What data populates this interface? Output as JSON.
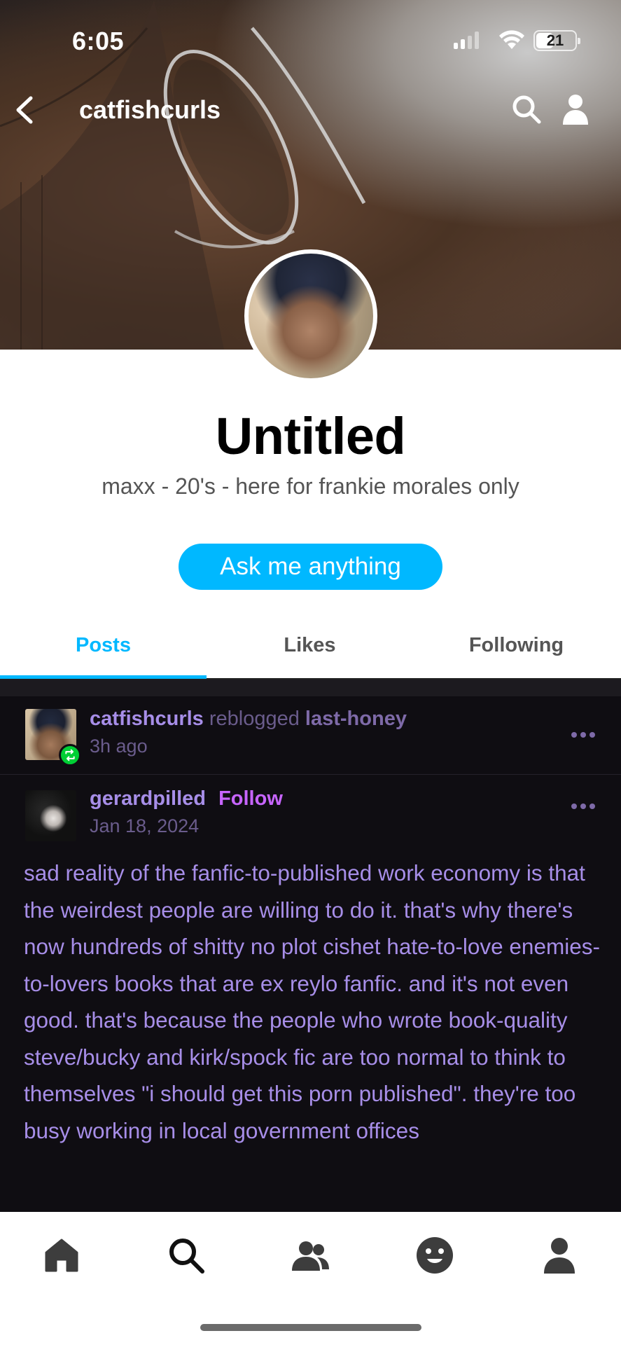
{
  "status_bar": {
    "time": "6:05",
    "battery_level": "21"
  },
  "nav": {
    "title": "catfishcurls"
  },
  "profile": {
    "title": "Untitled",
    "description": "maxx - 20's - here for frankie morales only",
    "ask_button_label": "Ask me anything"
  },
  "tabs": [
    {
      "label": "Posts",
      "active": true
    },
    {
      "label": "Likes",
      "active": false
    },
    {
      "label": "Following",
      "active": false
    }
  ],
  "post": {
    "reblogger": "catfishcurls",
    "reblog_verb": "reblogged",
    "reblog_source": "last-honey",
    "reblog_time": "3h ago",
    "op_user": "gerardpilled",
    "op_follow_label": "Follow",
    "op_date": "Jan 18, 2024",
    "body": "sad reality of the fanfic-to-published work economy is that the weirdest people are willing to do it. that's why there's now hundreds of shitty no plot cishet hate-to-love enemies-to-lovers books that are ex reylo fanfic. and it's not even good. that's because the people who wrote book-quality steve/bucky and kirk/spock fic are too normal to think to themselves \"i should get this porn published\". they're too busy working in local government offices"
  },
  "bottom_nav": [
    "home-icon",
    "search-icon",
    "people-icon",
    "smiley-icon",
    "account-icon"
  ],
  "colors": {
    "accent": "#00b8ff",
    "post_text": "#a78ee8",
    "follow": "#c765ff",
    "reblog_badge": "#00cf35",
    "feed_bg": "#0f0d12"
  }
}
